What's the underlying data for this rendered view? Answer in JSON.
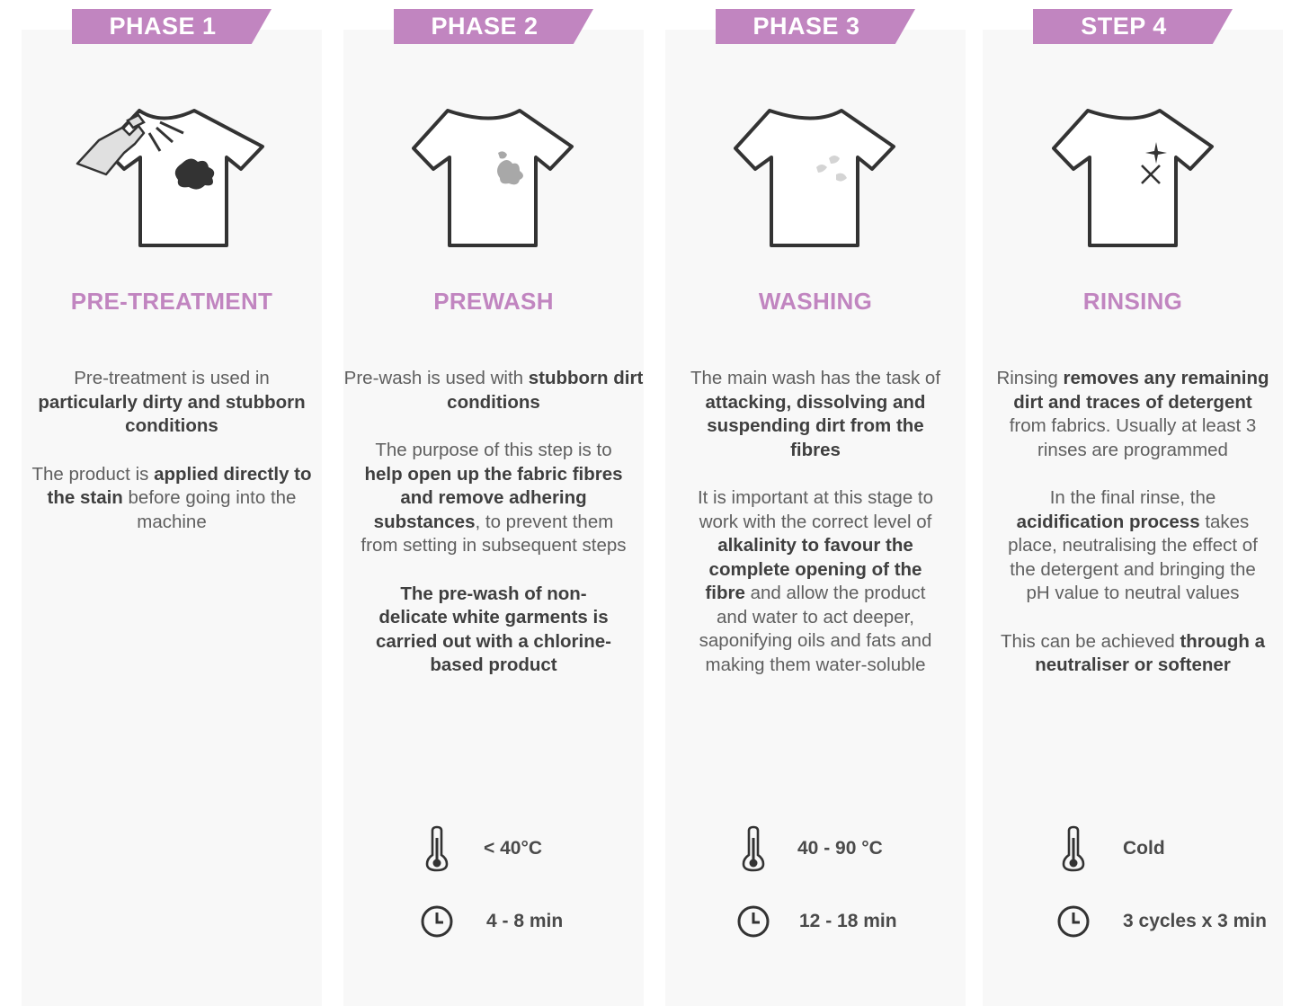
{
  "colors": {
    "accent": "#c185c0",
    "panel": "#f8f8f8",
    "text": "#5f5f5f",
    "text_bold": "#3f3f3f",
    "icon_stroke": "#333333"
  },
  "columns": [
    {
      "tab": "PHASE 1",
      "title": "PRE-TREATMENT",
      "icon": "tshirt-spray-stain-icon",
      "para1": [
        "Pre-treatment is used in",
        "particularly dirty and stubborn conditions"
      ],
      "para2": [
        "The product is",
        "applied directly to the stain",
        "before going into the machine"
      ]
    },
    {
      "tab": "PHASE 2",
      "title": "PREWASH",
      "icon": "tshirt-grey-stain-icon",
      "para1": [
        "Pre-wash is used with",
        "stubborn dirt conditions"
      ],
      "para2": [
        "The purpose of this step is to",
        "help open up the fabric fibres and remove adhering substances",
        ", to prevent them from setting in subsequent steps"
      ],
      "para3": "The pre-wash of non-delicate white garments is carried out with a chlorine-based product",
      "temperature": "< 40°C",
      "time": "4 - 8 min"
    },
    {
      "tab": "PHASE 3",
      "title": "WASHING",
      "icon": "tshirt-light-stain-icon",
      "para1": [
        "The main wash has the task of",
        "attacking, dissolving and suspending dirt from the fibres"
      ],
      "para2": [
        "It is important at this stage to work with the correct level of",
        "alkalinity to favour the complete opening of the fibre",
        "and allow the product and water to act deeper, saponifying oils and fats and making them water-soluble"
      ],
      "temperature": "40 - 90 °C",
      "time": "12 - 18 min"
    },
    {
      "tab": "STEP 4",
      "title": "RINSING",
      "icon": "tshirt-sparkle-icon",
      "para1": [
        "Rinsing",
        "removes any remaining dirt and traces of detergent",
        "from fabrics. Usually at least 3 rinses are programmed"
      ],
      "para2": [
        "In the final rinse, the",
        "acidification process",
        "takes place, neutralising the effect of the detergent and bringing the pH value to neutral values"
      ],
      "para3": [
        "This can be achieved",
        "through a neutraliser or softener"
      ],
      "temperature": "Cold",
      "time": "3 cycles x 3 min"
    }
  ]
}
